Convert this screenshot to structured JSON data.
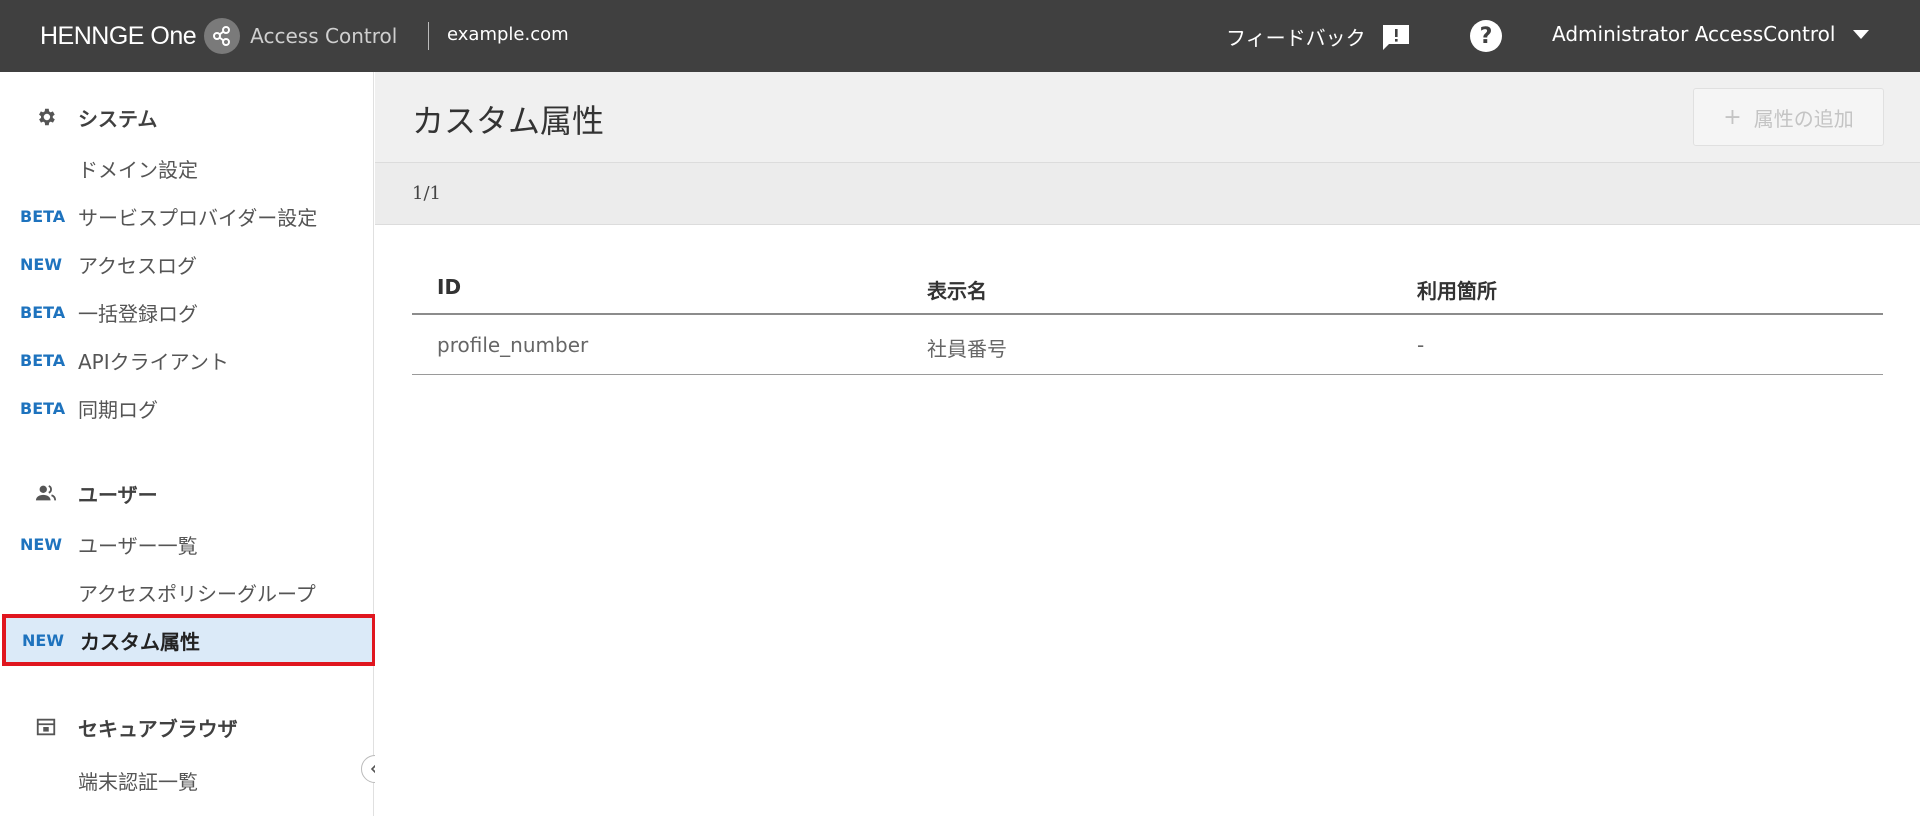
{
  "header": {
    "brand_name": "HENNGE One",
    "product_name": "Access Control",
    "domain": "example.com",
    "feedback_label": "フィードバック",
    "help_glyph": "?",
    "user_name": "Administrator AccessControl",
    "bg_color": "#404040"
  },
  "sidebar": {
    "sections": [
      {
        "label": "システム",
        "icon": "gear-icon"
      },
      {
        "label": "ユーザー",
        "icon": "users-icon"
      },
      {
        "label": "セキュアブラウザ",
        "icon": "browser-window-icon"
      }
    ],
    "items": [
      {
        "badge": "",
        "label": "ドメイン設定"
      },
      {
        "badge": "BETA",
        "label": "サービスプロバイダー設定"
      },
      {
        "badge": "NEW",
        "label": "アクセスログ"
      },
      {
        "badge": "BETA",
        "label": "一括登録ログ"
      },
      {
        "badge": "BETA",
        "label": "APIクライアント"
      },
      {
        "badge": "BETA",
        "label": "同期ログ"
      },
      {
        "badge": "NEW",
        "label": "ユーザー一覧"
      },
      {
        "badge": "",
        "label": "アクセスポリシーグループ"
      },
      {
        "badge": "NEW",
        "label": "カスタム属性"
      },
      {
        "badge": "",
        "label": "端末認証一覧"
      }
    ],
    "active_item": "カスタム属性",
    "badge_color": "#1e73be",
    "active_bg": "#dbeaf8",
    "highlight_border": "#e0161f"
  },
  "main": {
    "title": "カスタム属性",
    "add_button_label": "属性の追加",
    "pager": "1/1",
    "table": {
      "headers": [
        "ID",
        "表示名",
        "利用箇所"
      ],
      "rows": [
        [
          "profile_number",
          "社員番号",
          "-"
        ]
      ]
    }
  }
}
